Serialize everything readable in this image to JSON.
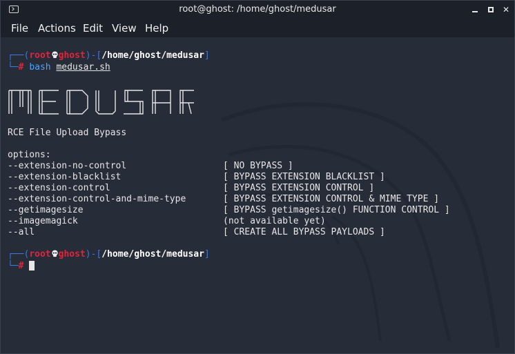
{
  "window": {
    "title": "root@ghost: /home/ghost/medusar"
  },
  "menu": [
    "File",
    "Actions",
    "Edit",
    "View",
    "Help"
  ],
  "prompt1": {
    "open": "┌──(",
    "user": "root",
    "host": "ghost",
    "mid": ")-[",
    "path": "/home/ghost/medusar",
    "close": "]",
    "line2_prefix": "└─",
    "hash": "#",
    "command": "bash",
    "arg": "medusar.sh"
  },
  "banner_text": "MEDUSAR",
  "subtitle": "RCE File Upload Bypass",
  "options_header": "options:",
  "options": [
    {
      "flag": "--extension-no-control",
      "desc": "[ NO BYPASS ]"
    },
    {
      "flag": "--extension-blacklist",
      "desc": "[ BYPASS EXTENSION BLACKLIST ]"
    },
    {
      "flag": "--extension-control",
      "desc": "[ BYPASS EXTENSION CONTROL ]"
    },
    {
      "flag": "--extension-control-and-mime-type",
      "desc": "[ BYPASS EXTENSION CONTROL & MIME TYPE ]"
    },
    {
      "flag": "--getimagesize",
      "desc": "[ BYPASS getimagesize() FUNCTION CONTROL ]"
    },
    {
      "flag": "--imagemagick",
      "desc": "(not available yet)"
    },
    {
      "flag": "--all",
      "desc": "[ CREATE ALL BYPASS PAYLOADS ]"
    }
  ],
  "prompt2": {
    "open": "┌──(",
    "user": "root",
    "host": "ghost",
    "mid": ")-[",
    "path": "/home/ghost/medusar",
    "close": "]",
    "line2_prefix": "└─",
    "hash": "#"
  },
  "icons": {
    "app": "terminal-icon",
    "skull": "skull-icon",
    "minimize": "minimize-icon",
    "maximize": "maximize-icon",
    "close": "close-icon"
  },
  "colors": {
    "prompt_blue": "#3f76d9",
    "prompt_red": "#e0253b",
    "command_blue": "#4fa3ff",
    "terminal_bg": "#262c38"
  }
}
